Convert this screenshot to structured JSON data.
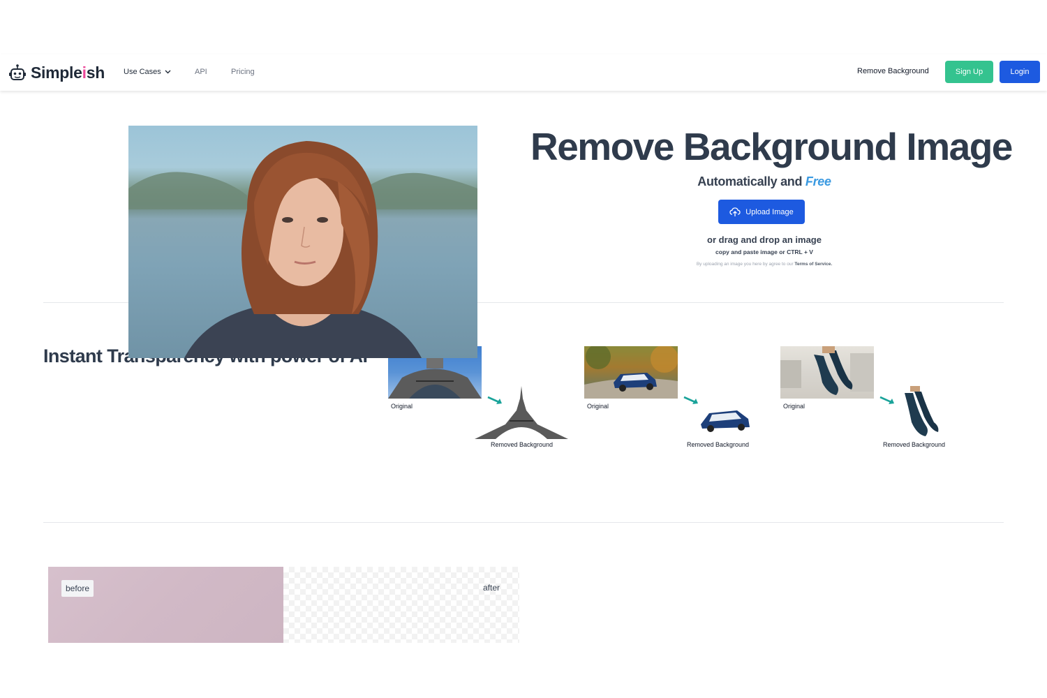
{
  "nav": {
    "brand_prefix": "Simple",
    "brand_accent": "i",
    "brand_suffix": "sh",
    "use_cases": "Use Cases",
    "api": "API",
    "pricing": "Pricing",
    "remove_background": "Remove Background",
    "sign_up": "Sign Up",
    "login": "Login"
  },
  "hero": {
    "title": "Remove Background Image",
    "subtitle_prefix": "Automatically and ",
    "subtitle_accent": "Free",
    "upload_label": "Upload Image",
    "drag_text": "or drag and drop an image",
    "paste_text": "copy and paste image or CTRL + V",
    "terms_prefix": "By uploading an image you here by agree to our ",
    "terms_link": "Terms of Service."
  },
  "section2": {
    "title": "Instant Transparency with power of AI",
    "examples": [
      {
        "original_label": "Original",
        "result_label": "Removed Background"
      },
      {
        "original_label": "Original",
        "result_label": "Removed Background"
      },
      {
        "original_label": "Original",
        "result_label": "Removed Background"
      }
    ]
  },
  "compare": {
    "before": "before",
    "after": "after"
  },
  "colors": {
    "primary": "#1d5ae0",
    "signup": "#34c38f",
    "accent_pink": "#ec4899",
    "free_blue": "#3b9ae1",
    "heading": "#2f3b4c"
  }
}
